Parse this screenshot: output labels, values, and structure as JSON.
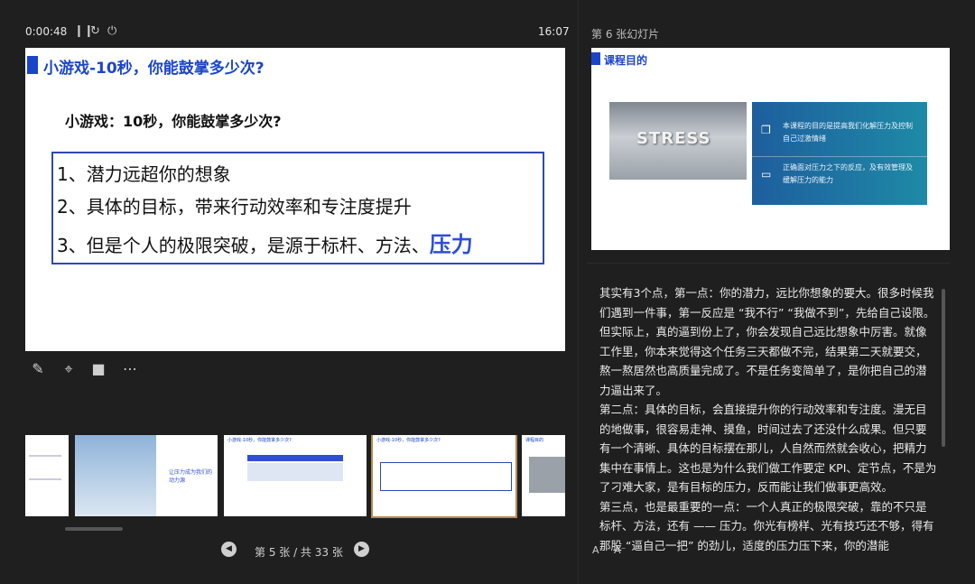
{
  "header": {
    "elapsed": "0:00:48",
    "pause_icon": "pause-icon",
    "restart_icon": "restart-icon",
    "end_icon": "power-icon",
    "clock": "16:07",
    "next_label": "第 6 张幻灯片"
  },
  "current_slide": {
    "title": "小游戏-10秒，你能鼓掌多少次?",
    "subtitle": "小游戏：10秒，你能鼓掌多少次?",
    "line1": "1、潜力远超你的想象",
    "line2": "2、具体的目标，带来行动效率和专注度提升",
    "line3": "3、但是个人的极限突破，是源于标杆、方法、",
    "line3_highlight": "压力"
  },
  "tools": [
    "pen-icon",
    "laser-target-icon",
    "camera-icon",
    "more-icon"
  ],
  "thumbnails": [
    {
      "title": ""
    },
    {
      "title": "让压力成为我们的动力源"
    },
    {
      "title": "小游戏-10秒，你能鼓掌多少次?"
    },
    {
      "title": "小游戏-10秒，你能鼓掌多少次?"
    },
    {
      "title": "课程目的"
    }
  ],
  "pager": {
    "text": "第 5 张 / 共 33 张"
  },
  "next_slide": {
    "title": "课程目的",
    "image_word": "STRESS",
    "point1": "本课程的目的是提高我们化解压力及控制自己过激情绪",
    "point2": "正确面对压力之下的反应，及有效管理及缓解压力的能力"
  },
  "notes": {
    "p1": "其实有3个点，第一点：你的潜力，远比你想象的要大。很多时候我们遇到一件事，第一反应是 “我不行” “我做不到”，先给自己设限。但实际上，真的逼到份上了，你会发现自己远比想象中厉害。就像工作里，你本来觉得这个任务三天都做不完，结果第二天就要交，熬一熬居然也高质量完成了。不是任务变简单了，是你把自己的潜力逼出来了。",
    "p2": "第二点：具体的目标，会直接提升你的行动效率和专注度。漫无目的地做事，很容易走神、摸鱼，时间过去了还没什么成果。但只要有一个清晰、具体的目标摆在那儿，人自然而然就会收心，把精力集中在事情上。这也是为什么我们做工作要定 KPI、定节点，不是为了刁难大家，是有目标的压力，反而能让我们做事更高效。",
    "p3": "第三点，也是最重要的一点：一个人真正的极限突破，靠的不只是标杆、方法，还有 —— 压力。你光有榜样、光有技巧还不够，得有那股 “逼自己一把” 的劲儿，适度的压力压下来，你的潜能"
  },
  "font_controls": {
    "increase": "A⁺",
    "decrease": "A⁻"
  }
}
